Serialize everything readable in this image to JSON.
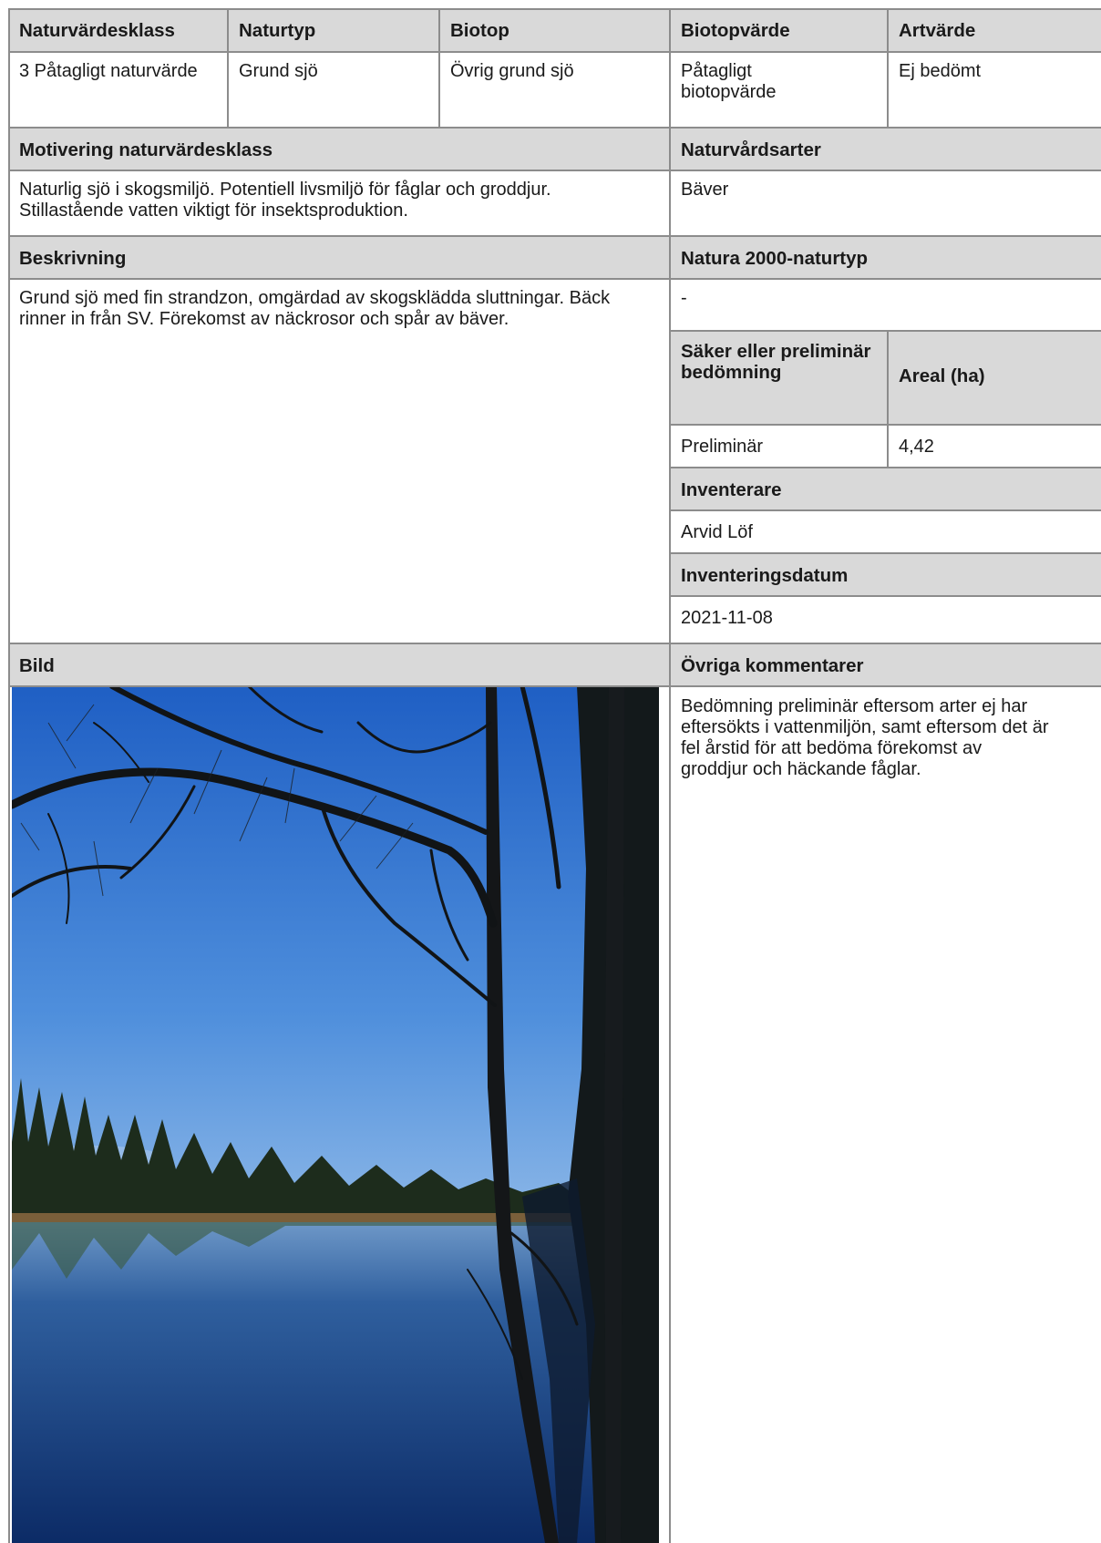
{
  "header": {
    "naturvardesklass": "Naturvärdesklass",
    "naturtyp": "Naturtyp",
    "biotop": "Biotop",
    "biotopvarde": "Biotopvärde",
    "artvarde": "Artvärde"
  },
  "values": {
    "naturvardesklass": "3 Påtagligt naturvärde",
    "naturtyp": "Grund sjö",
    "biotop": "Övrig grund sjö",
    "biotopvarde": "Påtagligt biotopvärde",
    "artvarde": "Ej bedömt"
  },
  "motivering": {
    "label": "Motivering naturvärdesklass",
    "text": "Naturlig sjö i skogsmiljö. Potentiell livsmiljö för fåglar och groddjur. Stillastående vatten viktigt för insektsproduktion."
  },
  "naturvardsarter": {
    "label": "Naturvårdsarter",
    "text": "Bäver"
  },
  "beskrivning": {
    "label": "Beskrivning",
    "text": "Grund sjö med fin strandzon, omgärdad av skogsklädda sluttningar. Bäck rinner in från SV. Förekomst av näckrosor och spår av bäver."
  },
  "natura2000": {
    "label": "Natura 2000-naturtyp",
    "text": "-"
  },
  "bedomning": {
    "label": "Säker eller preliminär bedömning",
    "value": "Preliminär"
  },
  "areal": {
    "label": "Areal (ha)",
    "value": "4,42"
  },
  "inventerare": {
    "label": "Inventerare",
    "value": "Arvid Löf"
  },
  "datum": {
    "label": "Inventeringsdatum",
    "value": "2021-11-08"
  },
  "bild": {
    "label": "Bild"
  },
  "kommentarer": {
    "label": "Övriga kommentarer",
    "text": "Bedömning preliminär eftersom arter ej har eftersökts i vattenmiljön, samt eftersom det är fel årstid för att bedöma förekomst av groddjur och häckande fåglar."
  },
  "colors": {
    "header_bg": "#d9d9d9",
    "border": "#8c8c8c"
  }
}
